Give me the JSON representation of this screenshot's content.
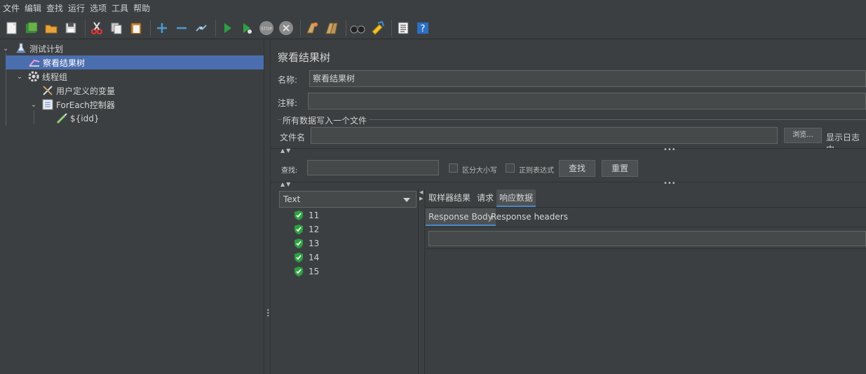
{
  "menu": [
    "文件",
    "编辑",
    "查找",
    "运行",
    "选项",
    "工具",
    "帮助"
  ],
  "toolbar": {
    "icons": [
      "new-icon",
      "templates-icon",
      "open-icon",
      "save-icon",
      "cut-icon",
      "copy-icon",
      "paste-icon",
      "expand-icon",
      "collapse-icon",
      "toggle-icon",
      "start-icon",
      "start-no-pause-icon",
      "stop-icon",
      "shutdown-icon",
      "clear-icon",
      "clear-all-icon",
      "search-icon",
      "reset-search-icon",
      "function-helper-icon",
      "help-icon"
    ]
  },
  "tree": {
    "items": [
      {
        "label": "测试计划",
        "icon": "test-plan-icon"
      },
      {
        "label": "察看结果树",
        "icon": "result-tree-icon"
      },
      {
        "label": "线程组",
        "icon": "thread-group-icon"
      },
      {
        "label": "用户定义的变量",
        "icon": "user-variables-icon"
      },
      {
        "label": "ForEach控制器",
        "icon": "foreach-controller-icon"
      },
      {
        "label": "${idd}",
        "icon": "sampler-icon"
      }
    ]
  },
  "panel": {
    "title": "察看结果树",
    "name_label": "名称:",
    "name_value": "察看结果树",
    "comment_label": "注释:",
    "comment_value": "",
    "group_title": "所有数据写入一个文件",
    "filename_label": "文件名",
    "filename_value": "",
    "browse_label": "浏览...",
    "log_display_label": "显示日志内",
    "search_label": "查找:",
    "search_value": "",
    "case_sensitive_label": "区分大小写",
    "regex_label": "正则表达式",
    "find_button": "查找",
    "reset_button": "重置"
  },
  "results": {
    "renderer": "Text",
    "items": [
      "11",
      "12",
      "13",
      "14",
      "15"
    ]
  },
  "tabs": {
    "main": [
      "取样器结果",
      "请求",
      "响应数据"
    ],
    "active_main": "响应数据",
    "sub": [
      "Response Body",
      "Response headers"
    ],
    "active_sub": "Response Body"
  },
  "colors": {
    "background": "#3c3f41",
    "selection": "#4b6eaf",
    "success": "#2ea043"
  }
}
